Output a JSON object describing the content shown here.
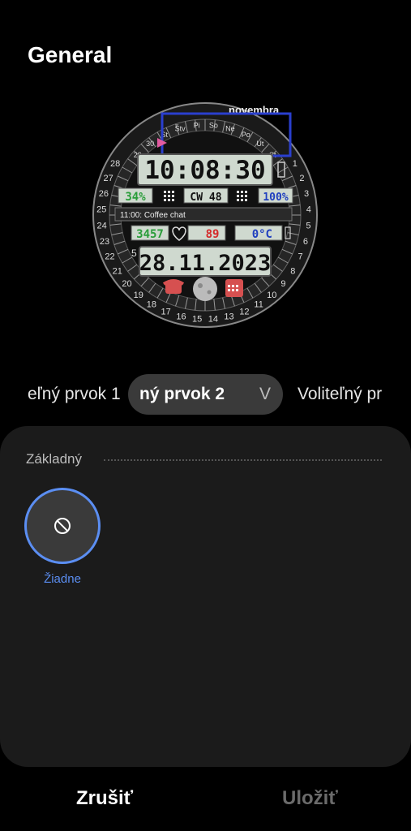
{
  "header": {
    "title": "General"
  },
  "watch_face": {
    "month": "novembra",
    "time": "10:08:30",
    "calendar_week": "CW 48",
    "battery_left": "34%",
    "battery_right": "100%",
    "event": "11:00: Coffee chat",
    "steps": "3457",
    "heart_rate": "89",
    "temperature": "0°C",
    "date": "28.11.2023",
    "dial_number_left": "5",
    "top_days": [
      "29",
      "30",
      "St",
      "Štv",
      "Pi",
      "So",
      "Ne",
      "Po",
      "Ut",
      "St"
    ],
    "ring_numbers": [
      "28",
      "27",
      "26",
      "25",
      "24",
      "23",
      "22",
      "21",
      "20",
      "19",
      "18",
      "17",
      "16",
      "15",
      "14",
      "13",
      "12",
      "11",
      "10",
      "9",
      "8",
      "7",
      "6",
      "5",
      "4",
      "3",
      "2",
      "1"
    ]
  },
  "carousel": {
    "left_tab": "eľný prvok 1",
    "active_tab": "ný prvok 2",
    "active_next_peek": "V",
    "right_tab": "Voliteľný pr"
  },
  "sheet": {
    "section_label": "Základný",
    "option_none_label": "Žiadne"
  },
  "footer": {
    "cancel_label": "Zrušiť",
    "save_label": "Uložiť"
  },
  "colors": {
    "accent": "#5b8ef2",
    "lcd": "#cfd9cf",
    "battery_green": "#2a9d3a",
    "battery_blue": "#1f3fbf",
    "heart_red": "#d42a2a"
  }
}
